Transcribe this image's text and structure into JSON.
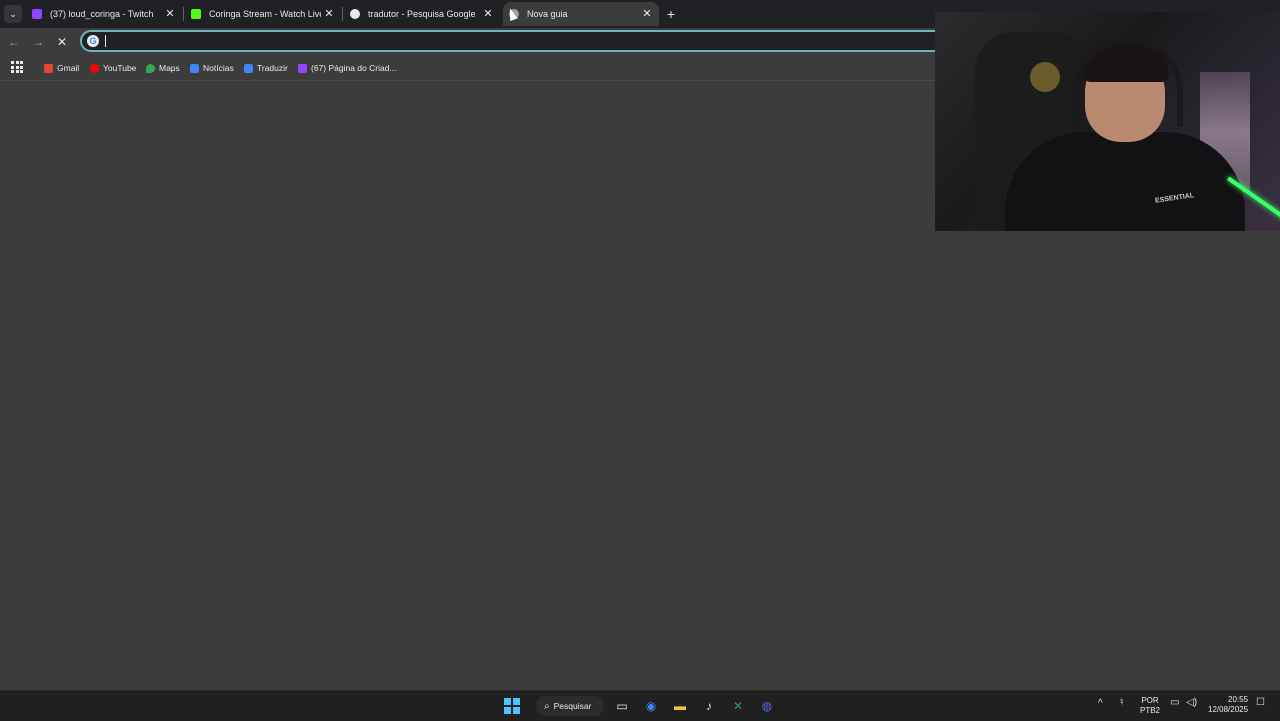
{
  "tabs": [
    {
      "title": "(37) loud_coringa - Twitch",
      "color": "#9146ff",
      "active": false
    },
    {
      "title": "Coringa Stream - Watch Live on",
      "color": "#53fc18",
      "active": false
    },
    {
      "title": "tradutor - Pesquisa Google",
      "color": "#e8eaed",
      "active": false
    },
    {
      "title": "Nova guia",
      "color": "#9aa0a6",
      "active": true
    }
  ],
  "close_symbol": "✕",
  "new_tab_symbol": "+",
  "omnibox": {
    "value": "",
    "placeholder": ""
  },
  "bookmarks": [
    {
      "label": "Gmail",
      "color": "#ea4335"
    },
    {
      "label": "YouTube",
      "color": "#ff0000"
    },
    {
      "label": "Maps",
      "color": "#34a853"
    },
    {
      "label": "Notícias",
      "color": "#4285f4"
    },
    {
      "label": "Traduzir",
      "color": "#4285f4"
    },
    {
      "label": "(67) Página do Criad...",
      "color": "#9146ff"
    }
  ],
  "webcam": {
    "hoodie_text": "ESSENTIAL"
  },
  "taskbar": {
    "search_label": "Pesquisar",
    "lang_top": "POR",
    "lang_bottom": "PTB2",
    "time": "20:55",
    "date": "12/08/2025"
  }
}
